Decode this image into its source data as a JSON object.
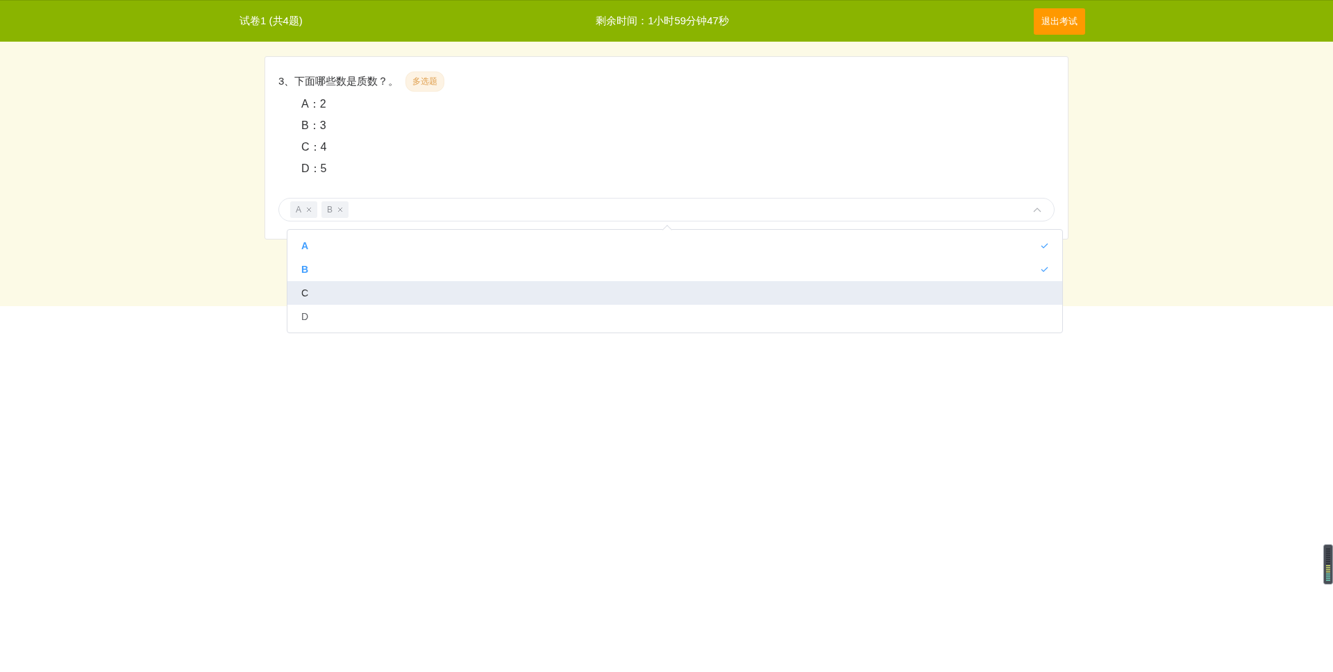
{
  "header": {
    "title": "试卷1 (共4题)",
    "timer": "剩余时间：1小时59分钟47秒",
    "exit_button": "退出考试"
  },
  "question": {
    "text": "3、下面哪些数是质数？。",
    "type_tag": "多选题",
    "options": [
      "A：2",
      "B：3",
      "C：4",
      "D：5"
    ]
  },
  "answer_select": {
    "expanded": true,
    "tags": [
      "A",
      "B"
    ],
    "dropdown": [
      {
        "label": "A",
        "selected": true,
        "highlighted": false
      },
      {
        "label": "B",
        "selected": true,
        "highlighted": false
      },
      {
        "label": "C",
        "selected": false,
        "highlighted": true
      },
      {
        "label": "D",
        "selected": false,
        "highlighted": false
      }
    ]
  }
}
